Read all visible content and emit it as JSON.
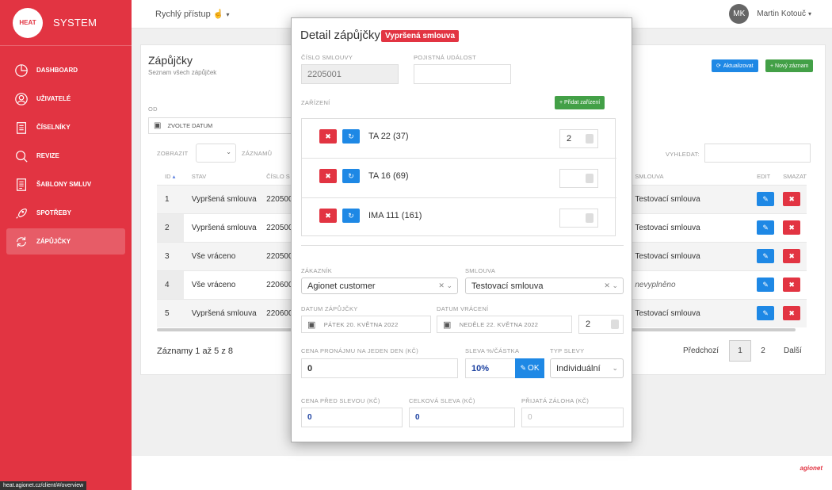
{
  "sidebar": {
    "logo_text": "HEAT",
    "app_name": "SYSTEM",
    "items": [
      {
        "label": "DASHBOARD",
        "icon": "chart-pie-icon"
      },
      {
        "label": "UŽIVATELÉ",
        "icon": "user-icon"
      },
      {
        "label": "ČÍSELNÍKY",
        "icon": "clipboard-icon"
      },
      {
        "label": "REVIZE",
        "icon": "search-icon"
      },
      {
        "label": "ŠABLONY SMLUV",
        "icon": "document-icon"
      },
      {
        "label": "SPOTŘEBY",
        "icon": "rocket-icon"
      },
      {
        "label": "ZÁPŮJČKY",
        "icon": "refresh-icon"
      }
    ],
    "active": "ZÁPŮJČKY"
  },
  "status_url": "heat.agionet.cz/client/#/overview",
  "topbar": {
    "quick_access": "Rychlý přístup",
    "user_initials": "MK",
    "user_name": "Martin Kotouč"
  },
  "page": {
    "title": "Zápůjčky",
    "subtitle": "Seznam všech zápůjček",
    "refresh_btn": "Aktualizovat",
    "new_btn": "+ Nový záznam",
    "from_label": "OD",
    "date_placeholder": "ZVOLTE DATUM",
    "show_label": "ZOBRAZIT",
    "records_label": "ZÁZNAMŮ",
    "search_label": "VYHLEDAT:",
    "columns": [
      "ID",
      "STAV",
      "ČÍSLO S",
      "SMLOUVA",
      "EDIT",
      "SMAZAT"
    ],
    "rows": [
      {
        "id": "1",
        "stav": "Vypršená smlouva",
        "cislo": "220500",
        "smlouva": "Testovací smlouva"
      },
      {
        "id": "2",
        "stav": "Vypršená smlouva",
        "cislo": "220500",
        "smlouva": "Testovací smlouva"
      },
      {
        "id": "3",
        "stav": "Vše vráceno",
        "cislo": "220500",
        "smlouva": "Testovací smlouva"
      },
      {
        "id": "4",
        "stav": "Vše vráceno",
        "cislo": "220600",
        "smlouva": "nevyplněno"
      },
      {
        "id": "5",
        "stav": "Vypršená smlouva",
        "cislo": "220600",
        "smlouva": "Testovací smlouva"
      }
    ],
    "records_info": "Záznamy 1 až 5 z 8",
    "prev": "Předchozí",
    "page1": "1",
    "page2": "2",
    "next": "Další"
  },
  "modal": {
    "title": "Detail zápůjčky",
    "badge": "Vypršená smlouva",
    "contract_no_label": "ČÍSLO SMLOUVY",
    "contract_no": "2205001",
    "insurance_label": "POJISTNÁ UDÁLOST",
    "insurance_value": "",
    "devices_label": "ZAŘÍZENÍ",
    "add_device": "+ Přidat zařízení",
    "devices": [
      {
        "name": "TA 22 (37)",
        "qty": "2"
      },
      {
        "name": "TA 16 (69)",
        "qty": ""
      },
      {
        "name": "IMA 111 (161)",
        "qty": ""
      }
    ],
    "customer_label": "ZÁKAZNÍK",
    "customer": "Agionet customer",
    "contract_label": "SMLOUVA",
    "contract": "Testovací smlouva",
    "loan_date_label": "DATUM ZÁPŮJČKY",
    "loan_date": "PÁTEK 20. KVĚTNA 2022",
    "return_date_label": "DATUM VRÁCENÍ",
    "return_date": "NEDĚLE 22. KVĚTNA 2022",
    "days": "2",
    "price_label": "CENA PRONÁJMU NA JEDEN DEN (KČ)",
    "price": "0",
    "discount_label": "SLEVA %/ČÁSTKA",
    "discount": "10%",
    "ok": "OK",
    "discount_type_label": "TYP SLEVY",
    "discount_type": "Individuální",
    "price_before_label": "CENA PŘED SLEVOU (KČ)",
    "price_before": "0",
    "total_discount_label": "CELKOVÁ SLEVA (KČ)",
    "total_discount": "0",
    "deposit_label": "PŘIJATÁ ZÁLOHA (KČ)",
    "deposit_placeholder": "0"
  },
  "footer_brand": "agionet",
  "colors": {
    "brand": "#e23442",
    "primary": "#1e88e5",
    "success": "#43a047"
  }
}
